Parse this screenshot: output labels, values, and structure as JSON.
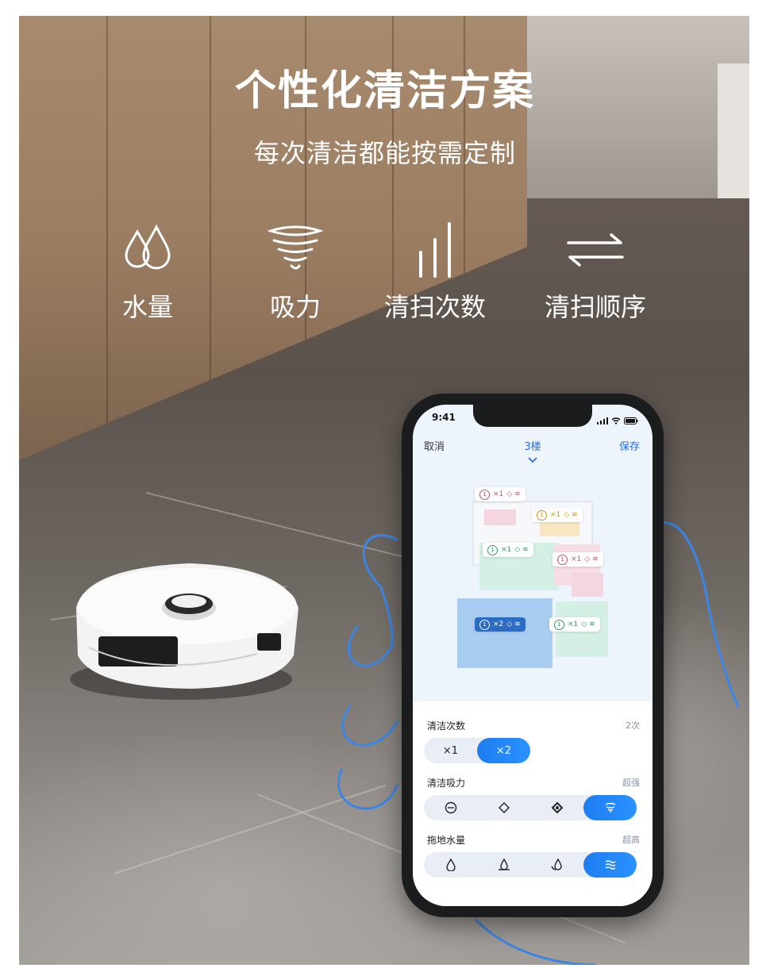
{
  "hero": {
    "title": "个性化清洁方案",
    "subtitle": "每次清洁都能按需定制"
  },
  "features": [
    {
      "label": "水量",
      "icon": "water-drops-icon"
    },
    {
      "label": "吸力",
      "icon": "tornado-icon"
    },
    {
      "label": "清扫次数",
      "icon": "bars-icon"
    },
    {
      "label": "清扫顺序",
      "icon": "arrows-swap-icon"
    }
  ],
  "phone": {
    "status_time": "9:41",
    "nav": {
      "cancel": "取消",
      "floor": "3楼",
      "save": "保存"
    },
    "map_tags": [
      {
        "num": "1",
        "count": "×1",
        "color": "#c0566b"
      },
      {
        "num": "1",
        "count": "×1",
        "color": "#c9971f"
      },
      {
        "num": "1",
        "count": "×1",
        "color": "#2f9a6a"
      },
      {
        "num": "1",
        "count": "×1",
        "color": "#c0566b"
      },
      {
        "num": "1",
        "count": "×2",
        "color": "#ffffff"
      },
      {
        "num": "1",
        "count": "×1",
        "color": "#2f9a6a"
      }
    ],
    "settings": {
      "times": {
        "label": "清洁次数",
        "value": "2次",
        "options": [
          "×1",
          "×2"
        ],
        "selected": 1
      },
      "suction": {
        "label": "清洁吸力",
        "value": "超强",
        "selected": 3
      },
      "water": {
        "label": "拖地水量",
        "value": "超高",
        "selected": 3
      }
    }
  },
  "colors": {
    "accent": "#1e7df0",
    "map_bg": "#eef4fb"
  }
}
